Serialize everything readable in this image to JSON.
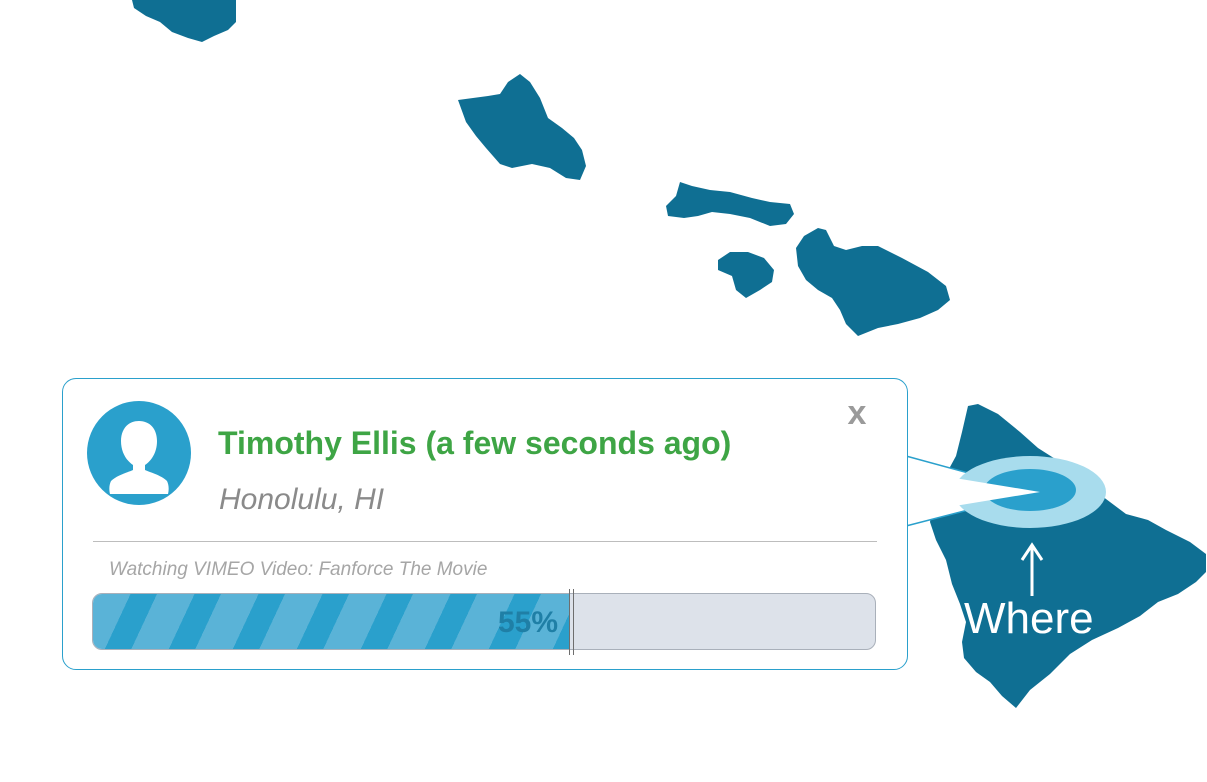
{
  "colors": {
    "island": "#0f6f93",
    "accent": "#2aa0cc",
    "name_green": "#3ea545",
    "ring_light": "#a8dced"
  },
  "popup": {
    "user_name": "Timothy Ellis (a few seconds ago)",
    "location": "Honolulu, HI",
    "close_label": "x",
    "activity": "Watching VIMEO Video: Fanforce The Movie",
    "progress_label": "55%",
    "progress_fraction": 0.61,
    "avatar_icon": "user-silhouette-icon"
  },
  "map": {
    "where_label": "Where",
    "arrow_icon": "up-arrow-icon"
  }
}
